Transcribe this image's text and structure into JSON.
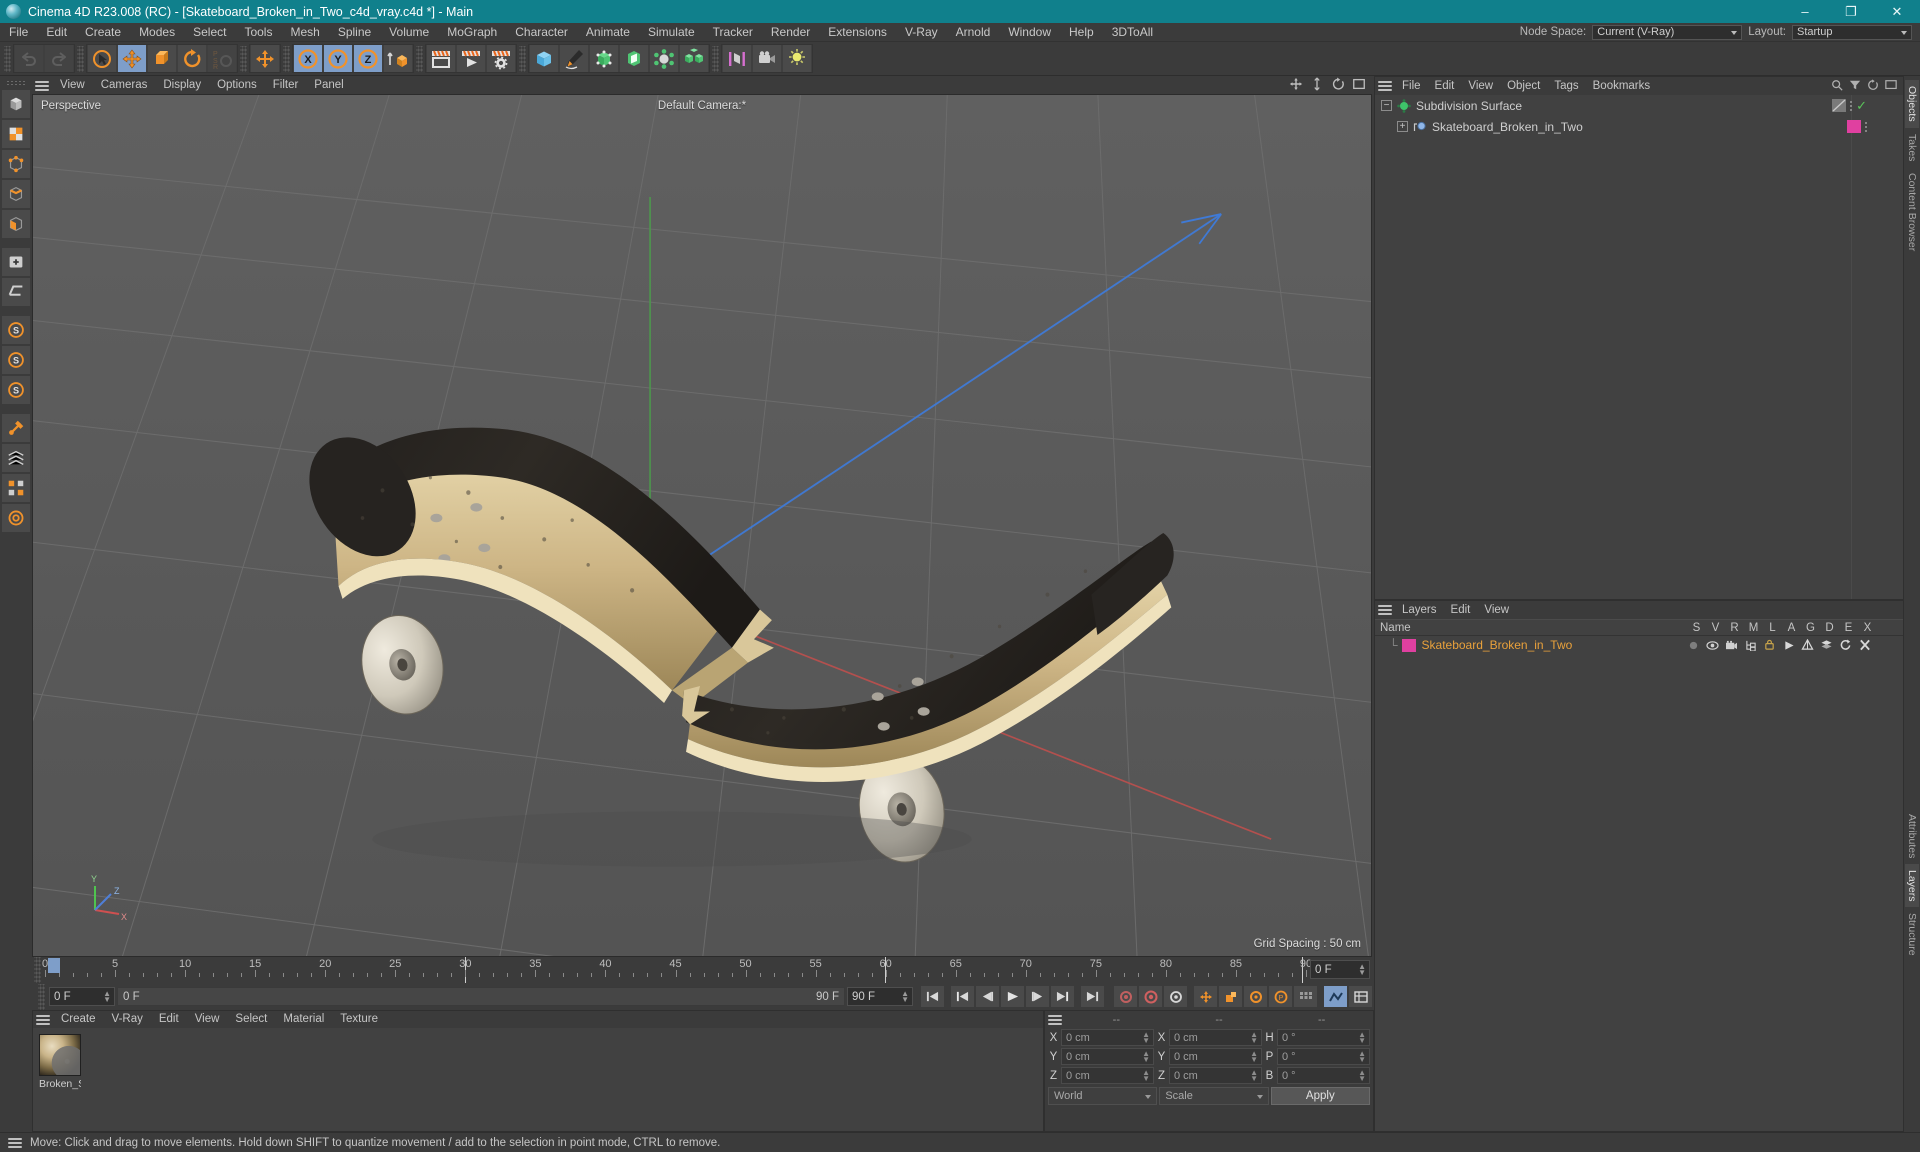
{
  "window": {
    "title": "Cinema 4D R23.008 (RC) - [Skateboard_Broken_in_Two_c4d_vray.c4d *] - Main",
    "minimize": "–",
    "maximize": "❐",
    "close": "✕"
  },
  "menubar": {
    "items": [
      "File",
      "Edit",
      "Create",
      "Modes",
      "Select",
      "Tools",
      "Mesh",
      "Spline",
      "Volume",
      "MoGraph",
      "Character",
      "Animate",
      "Simulate",
      "Tracker",
      "Render",
      "Extensions",
      "V-Ray",
      "Arnold",
      "Window",
      "Help",
      "3DToAll"
    ],
    "node_space_label": "Node Space:",
    "node_space_value": "Current (V-Ray)",
    "layout_label": "Layout:",
    "layout_value": "Startup"
  },
  "toolbar": {
    "undo": "undo-icon",
    "redo": "redo-icon",
    "select": "live-selection-icon",
    "move": "move-icon",
    "scale": "scale-icon",
    "rotate": "rotate-icon",
    "psr": "psr-icon",
    "world": "world-axis-icon",
    "axis_x": "X",
    "axis_y": "Y",
    "axis_z": "Z",
    "axis_w": "world-coordinate-icon",
    "render_view": "render-view-icon",
    "render_picture": "render-to-picture-viewer-icon",
    "render_settings": "render-settings-icon",
    "primitive": "cube-primitive-icon",
    "spline": "pen-spline-icon",
    "nurbs": "generator-icon",
    "deformer": "deformer-icon",
    "environment": "environment-icon",
    "array": "array-icon",
    "scene": "scene-icon",
    "camera": "camera-icon",
    "light": "light-icon"
  },
  "leftpalette": {
    "items": [
      "model-mode-icon",
      "texture-mode-icon",
      "points-mode-icon",
      "edges-mode-icon",
      "polygons-mode-icon",
      "enable-axis-icon",
      "workplane-icon",
      "snap-icon",
      "quantize-icon",
      "workplane-snap-icon",
      "lock-icon",
      "viewport-solo-icon",
      "grid-icon",
      "render-region-icon"
    ]
  },
  "viewport": {
    "menu": [
      "View",
      "Cameras",
      "Display",
      "Options",
      "Filter",
      "Panel"
    ],
    "perspective_label": "Perspective",
    "camera_label": "Default Camera:*",
    "grid_spacing": "Grid Spacing : 50 cm",
    "axis_gizmo": {
      "x": "X",
      "y": "Y",
      "z": "Z"
    },
    "icons": [
      "pan-icon",
      "zoom-icon",
      "rotate-view-icon",
      "maximize-view-icon"
    ]
  },
  "timeline": {
    "ticks": [
      "0",
      "5",
      "10",
      "15",
      "20",
      "25",
      "30",
      "35",
      "40",
      "45",
      "50",
      "55",
      "60",
      "65",
      "70",
      "75",
      "80",
      "85",
      "90"
    ],
    "current_frame": "0 F",
    "playhead_frame": "0 F",
    "range_start": "0 F",
    "range_end": "90 F",
    "preview_end": "90 F",
    "end_field": "90 F",
    "buttons": [
      "go-to-start-icon",
      "go-to-previous-keyframe-icon",
      "go-to-previous-frame-icon",
      "play-forwards-icon",
      "go-to-next-frame-icon",
      "go-to-next-keyframe-icon",
      "go-to-end-icon",
      "record-active-objects-icon",
      "autokeying-icon",
      "keyframe-selection-icon",
      "position-key-icon",
      "scale-key-icon",
      "rotation-key-icon",
      "param-key-icon",
      "pla-key-icon",
      "point-level-animation-icon",
      "animation-layers-icon"
    ]
  },
  "material_manager": {
    "menu": [
      "Create",
      "V-Ray",
      "Edit",
      "View",
      "Select",
      "Material",
      "Texture"
    ],
    "materials": [
      {
        "name": "Broken_S",
        "thumb": "material-preview-sphere"
      }
    ]
  },
  "coordinates": {
    "header": [
      "--",
      "--",
      "--"
    ],
    "rows": [
      {
        "label_pos": "X",
        "pos": "0 cm",
        "label_size": "X",
        "size": "0 cm",
        "label_rot": "H",
        "rot": "0 °"
      },
      {
        "label_pos": "Y",
        "pos": "0 cm",
        "label_size": "Y",
        "size": "0 cm",
        "label_rot": "P",
        "rot": "0 °"
      },
      {
        "label_pos": "Z",
        "pos": "0 cm",
        "label_size": "Z",
        "size": "0 cm",
        "label_rot": "B",
        "rot": "0 °"
      }
    ],
    "system": "World",
    "mode": "Scale",
    "apply": "Apply"
  },
  "object_manager": {
    "menu": [
      "File",
      "Edit",
      "View",
      "Object",
      "Tags",
      "Bookmarks"
    ],
    "icons": [
      "search-icon",
      "filter-icon",
      "history-icon",
      "layout-icon"
    ],
    "rows": [
      {
        "name": "Subdivision Surface",
        "icon": "subdivision-surface-icon",
        "tag": "display-tag",
        "check": "✓",
        "indent": 4,
        "selected": false
      },
      {
        "name": "Skateboard_Broken_in_Two",
        "icon": "polygon-object-icon",
        "tag": "layer-swatch",
        "swatch": "#e040a0",
        "indent": 20,
        "selected": false
      }
    ]
  },
  "layer_manager": {
    "menu": [
      "Layers",
      "Edit",
      "View"
    ],
    "name_header": "Name",
    "columns": [
      "S",
      "V",
      "R",
      "M",
      "L",
      "A",
      "G",
      "D",
      "E",
      "X"
    ],
    "rows": [
      {
        "name": "Skateboard_Broken_in_Two",
        "swatch": "#e040a0",
        "flags": [
          "solo-dot",
          "visible-eye",
          "render-camera",
          "manager-tree",
          "lock-padlock",
          "animation-play",
          "generator",
          "deformer",
          "expression",
          "xpresso"
        ]
      }
    ]
  },
  "edge_tabs": {
    "top": [
      "Objects",
      "Takes",
      "Content Browser"
    ],
    "bottom": [
      "Attributes",
      "Layers",
      "Structure"
    ],
    "active_top": "Objects",
    "active_bottom": "Layers"
  },
  "statusbar": {
    "text": "Move: Click and drag to move elements. Hold down SHIFT to quantize movement / add to the selection in point mode, CTRL to remove."
  },
  "colors": {
    "title_bar": "#10808c",
    "accent_blue": "#7e9ec9",
    "orange": "#e9a13b",
    "panel": "#3b3b3b",
    "list": "#414141",
    "viewport": "#5a5a5a"
  }
}
